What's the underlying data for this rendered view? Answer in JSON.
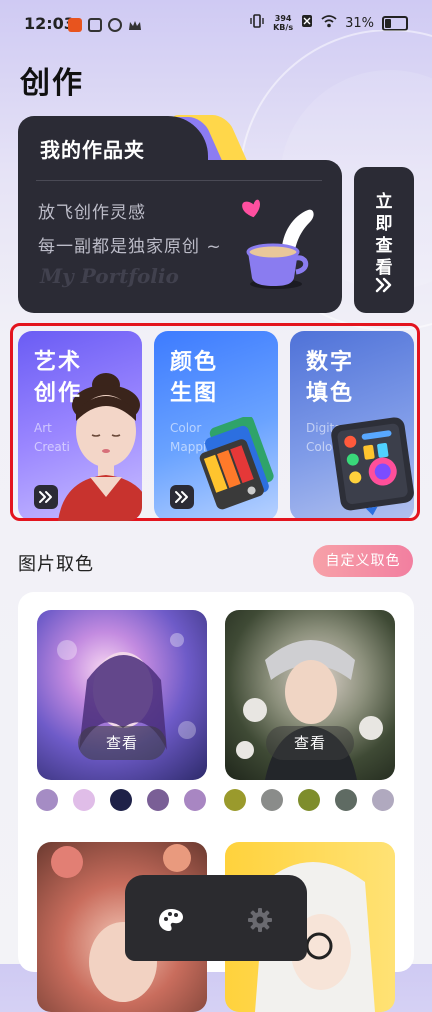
{
  "status_bar": {
    "time": "12:03",
    "net_speed_value": "394",
    "net_speed_unit": "KB/s",
    "battery": "31%"
  },
  "page": {
    "title": "创作"
  },
  "portfolio": {
    "label": "我的作品夹",
    "slogan_line1": "放飞创作灵感",
    "slogan_line2": "每一副都是独家原创 ~",
    "english_title": "My Portfolio",
    "view_now": "立即查看"
  },
  "categories": [
    {
      "name_line1": "艺术",
      "name_line2": "创作",
      "en_line1": "Art",
      "en_line2": "Creati"
    },
    {
      "name_line1": "颜色",
      "name_line2": "生图",
      "en_line1": "Color",
      "en_line2": "Mappi"
    },
    {
      "name_line1": "数字",
      "name_line2": "填色",
      "en_line1": "Digita",
      "en_line2": "Color"
    }
  ],
  "pick_color": {
    "title": "图片取色",
    "custom_button": "自定义取色",
    "view_label": "查看",
    "palettes": [
      [
        "#a58cc4",
        "#e0bde8",
        "#1e2148",
        "#7a5f96",
        "#a886c2"
      ],
      [
        "#9a9a2c",
        "#8a8c8a",
        "#7e8d2c",
        "#5f6b63",
        "#b0a9bf"
      ]
    ]
  },
  "colors": {
    "accent_dark": "#2b2b35",
    "highlight_red": "#e3141e"
  }
}
